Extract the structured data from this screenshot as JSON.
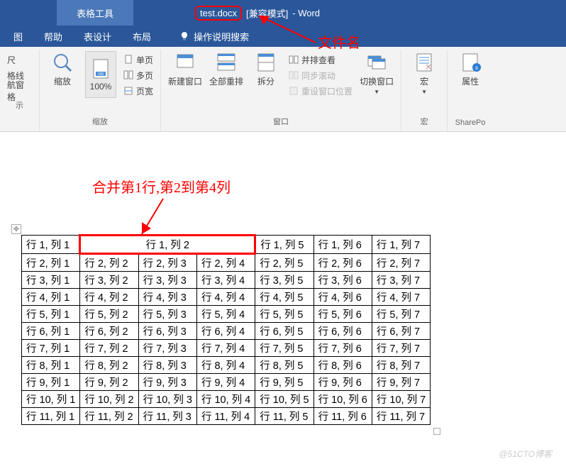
{
  "title": {
    "context_tab": "表格工具",
    "filename": "test.docx",
    "compat": "[兼容模式]",
    "app": "-  Word"
  },
  "tabs": {
    "view": "图",
    "help": "帮助",
    "design": "表设计",
    "layout": "布局",
    "tell_me": "操作说明搜索"
  },
  "ribbon": {
    "g1": {
      "ruler": "尺",
      "gridlines": "格线",
      "navpane": "航窗格",
      "label": "示"
    },
    "g2": {
      "zoom": "缩放",
      "pct": "100%",
      "onepage": "单页",
      "multipage": "多页",
      "pagewidth": "页宽",
      "label": "缩放"
    },
    "g3": {
      "newwin": "新建窗口",
      "arrange": "全部重排",
      "split": "拆分",
      "side": "并排查看",
      "sync": "同步滚动",
      "reset": "重设窗口位置",
      "switch": "切换窗口",
      "label": "窗口"
    },
    "g4": {
      "macros": "宏",
      "label": "宏"
    },
    "g5": {
      "props": "属性",
      "label": "SharePo"
    }
  },
  "annotations": {
    "filename_label": "文件名",
    "merge_label": "合并第1行,第2到第4列"
  },
  "table": {
    "headers": [
      "行 1, 列 1",
      "行 1, 列 2",
      "行 1, 列 5",
      "行 1, 列 6",
      "行 1, 列 7"
    ],
    "rows": [
      [
        "行 2, 列 1",
        "行 2, 列 2",
        "行 2, 列 3",
        "行 2, 列 4",
        "行 2, 列 5",
        "行 2, 列 6",
        "行 2, 列 7"
      ],
      [
        "行 3, 列 1",
        "行 3, 列 2",
        "行 3, 列 3",
        "行 3, 列 4",
        "行 3, 列 5",
        "行 3, 列 6",
        "行 3, 列 7"
      ],
      [
        "行 4, 列 1",
        "行 4, 列 2",
        "行 4, 列 3",
        "行 4, 列 4",
        "行 4, 列 5",
        "行 4, 列 6",
        "行 4, 列 7"
      ],
      [
        "行 5, 列 1",
        "行 5, 列 2",
        "行 5, 列 3",
        "行 5, 列 4",
        "行 5, 列 5",
        "行 5, 列 6",
        "行 5, 列 7"
      ],
      [
        "行 6, 列 1",
        "行 6, 列 2",
        "行 6, 列 3",
        "行 6, 列 4",
        "行 6, 列 5",
        "行 6, 列 6",
        "行 6, 列 7"
      ],
      [
        "行 7, 列 1",
        "行 7, 列 2",
        "行 7, 列 3",
        "行 7, 列 4",
        "行 7, 列 5",
        "行 7, 列 6",
        "行 7, 列 7"
      ],
      [
        "行 8, 列 1",
        "行 8, 列 2",
        "行 8, 列 3",
        "行 8, 列 4",
        "行 8, 列 5",
        "行 8, 列 6",
        "行 8, 列 7"
      ],
      [
        "行 9, 列 1",
        "行 9, 列 2",
        "行 9, 列 3",
        "行 9, 列 4",
        "行 9, 列 5",
        "行 9, 列 6",
        "行 9, 列 7"
      ],
      [
        "行 10, 列 1",
        "行 10, 列 2",
        "行 10, 列 3",
        "行 10, 列 4",
        "行 10, 列 5",
        "行 10, 列 6",
        "行 10, 列 7"
      ],
      [
        "行 11, 列 1",
        "行 11, 列 2",
        "行 11, 列 3",
        "行 11, 列 4",
        "行 11, 列 5",
        "行 11, 列 6",
        "行 11, 列 7"
      ]
    ]
  },
  "watermark": "@51CTO博客"
}
